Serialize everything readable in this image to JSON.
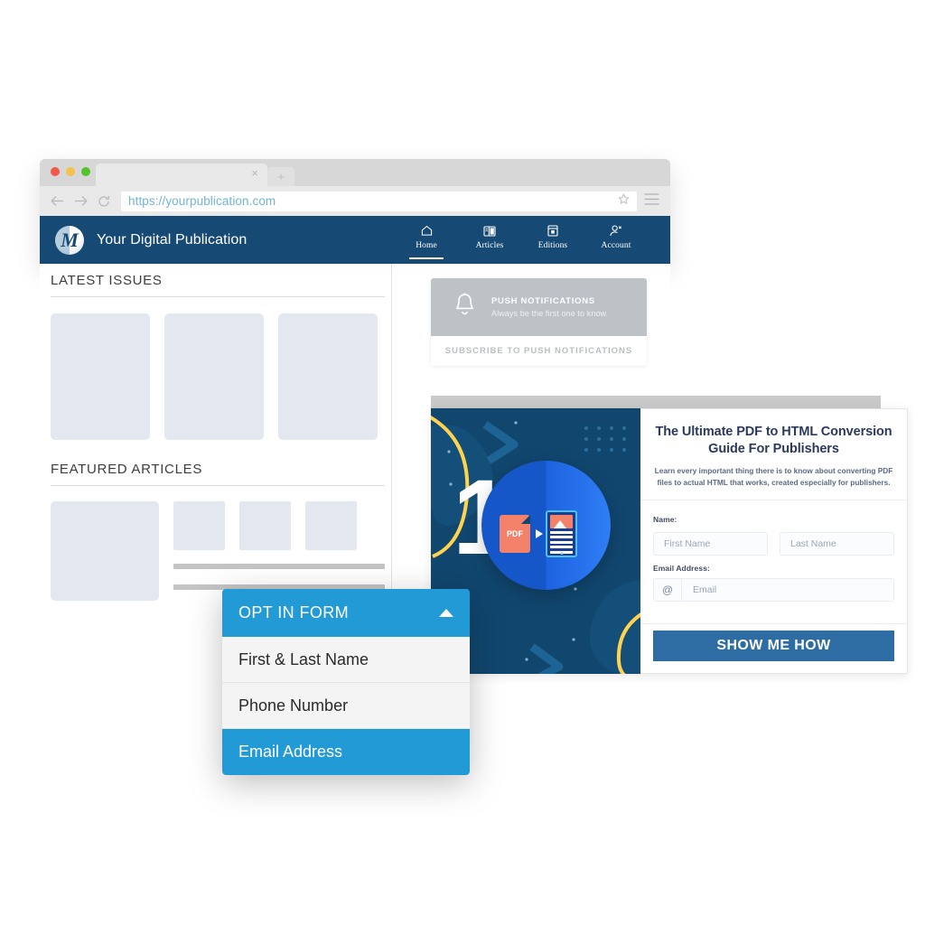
{
  "browser": {
    "tab_close_label": "×",
    "new_tab_label": "+",
    "url": "https://yourpublication.com"
  },
  "site": {
    "logo_letter": "M",
    "title": "Your Digital Publication",
    "nav": [
      {
        "label": "Home",
        "icon": "home-icon",
        "active": true
      },
      {
        "label": "Articles",
        "icon": "articles-icon",
        "active": false
      },
      {
        "label": "Editions",
        "icon": "editions-icon",
        "active": false
      },
      {
        "label": "Account",
        "icon": "account-icon",
        "active": false
      }
    ]
  },
  "content": {
    "latest_issues_title": "LATEST ISSUES",
    "featured_articles_title": "FEATURED ARTICLES"
  },
  "push": {
    "icon": "bell-icon",
    "title": "PUSH NOTIFICATIONS",
    "subtitle": "Always be the first one to know.",
    "button_label": "SUBSCRIBE TO PUSH NOTIFICATIONS"
  },
  "promo": {
    "heading": "The Ultimate PDF to HTML Conversion Guide For Publishers",
    "description": "Learn every important thing there is to know about converting PDF files to actual HTML that works, created especially for publishers.",
    "name_label": "Name:",
    "first_name_placeholder": "First Name",
    "last_name_placeholder": "Last Name",
    "email_label": "Email Address:",
    "email_at_symbol": "@",
    "email_placeholder": "Email",
    "cta_label": "SHOW ME HOW",
    "hero": {
      "big_number": "1",
      "pdf_label": "PDF"
    }
  },
  "dropdown": {
    "header_label": "OPT IN FORM",
    "caret_icon": "chevron-up-icon",
    "options": [
      {
        "label": "First & Last Name",
        "selected": false
      },
      {
        "label": "Phone Number",
        "selected": false
      },
      {
        "label": "Email Address",
        "selected": true
      }
    ]
  },
  "colors": {
    "navy": "#164a75",
    "accent_blue": "#229ad6",
    "cta_blue": "#2e6da4",
    "placeholder_grey": "#e3e7ef",
    "push_grey": "#bcc2c6"
  }
}
